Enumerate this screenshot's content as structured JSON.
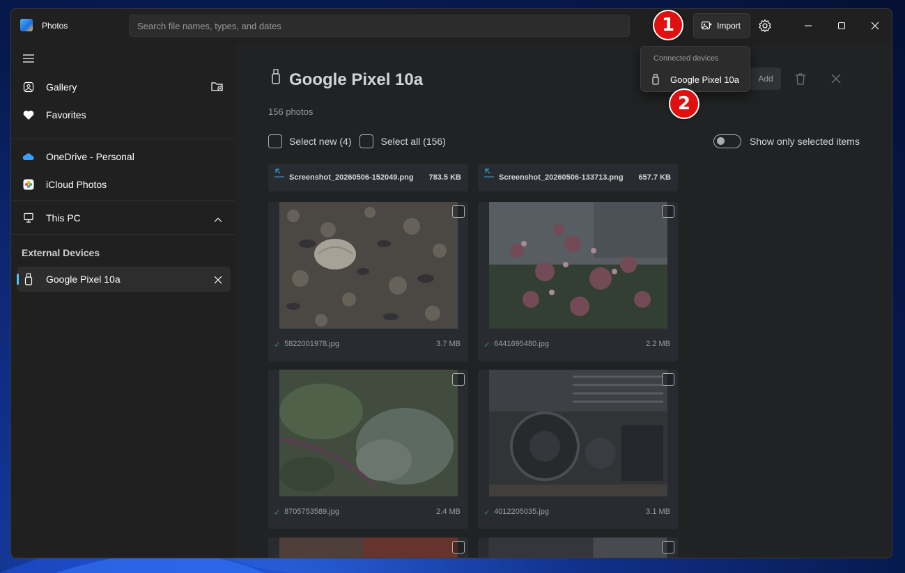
{
  "app": {
    "title": "Photos"
  },
  "search": {
    "placeholder": "Search file names, types, and dates"
  },
  "header": {
    "import_label": "Import"
  },
  "sidebar": {
    "items": [
      {
        "label": "Gallery"
      },
      {
        "label": "Favorites"
      },
      {
        "label": "OneDrive - Personal"
      },
      {
        "label": "iCloud Photos"
      },
      {
        "label": "This PC"
      }
    ],
    "external_devices_label": "External Devices",
    "device": {
      "label": "Google Pixel 10a"
    }
  },
  "main": {
    "title": "Google Pixel 10a",
    "count": "156 photos",
    "add_label": "Add",
    "select_new": "Select new (4)",
    "select_all": "Select all (156)",
    "show_selected": "Show only selected items"
  },
  "files": [
    {
      "name": "Screenshot_20260506-152049.png",
      "size": "783.5 KB"
    },
    {
      "name": "Screenshot_20260506-133713.png",
      "size": "657.7 KB"
    }
  ],
  "photos": [
    {
      "name": "5822001978.jpg",
      "size": "3.7 MB"
    },
    {
      "name": "6441695480.jpg",
      "size": "2.2 MB"
    },
    {
      "name": "8705753589.jpg",
      "size": "2.4 MB"
    },
    {
      "name": "4012205035.jpg",
      "size": "3.1 MB"
    }
  ],
  "popup": {
    "header": "Connected devices",
    "item": "Google Pixel 10a"
  },
  "annotations": {
    "step1": "1",
    "step2": "2"
  },
  "colors": {
    "accent": "#4cc2ff",
    "badge": "#e01010",
    "check": "#4a9d5b"
  }
}
